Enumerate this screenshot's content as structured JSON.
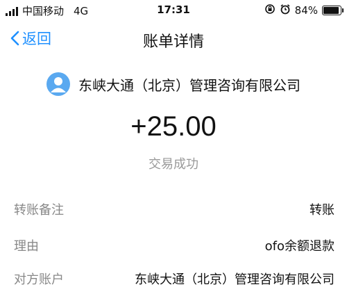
{
  "status_bar": {
    "carrier": "中国移动",
    "network": "4G",
    "time": "17:31",
    "battery_text": "84%",
    "battery_level": 0.84
  },
  "nav": {
    "back_label": "返回",
    "title": "账单详情"
  },
  "bill": {
    "payee_name": "东峡大通（北京）管理咨询有限公司",
    "amount": "+25.00",
    "status": "交易成功",
    "details": [
      {
        "label": "转账备注",
        "value": "转账"
      },
      {
        "label": "理由",
        "value": "ofo余额退款"
      },
      {
        "label": "对方账户",
        "value": "东峡大通（北京）管理咨询有限公司"
      }
    ]
  },
  "colors": {
    "accent": "#1e90ff",
    "avatar": "#5aa9f0",
    "muted": "#999999"
  }
}
